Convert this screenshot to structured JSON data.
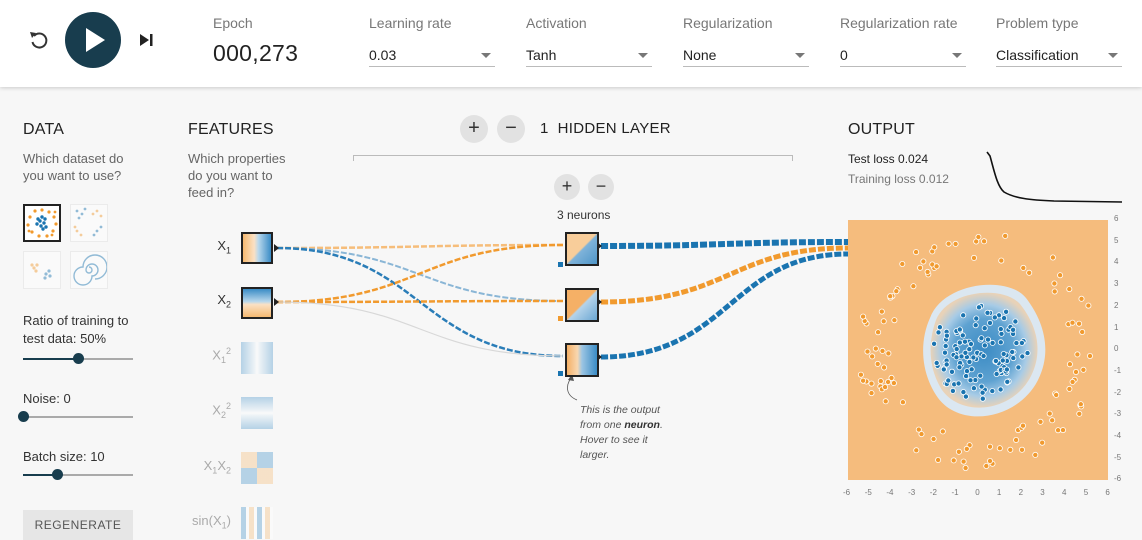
{
  "controls": {
    "epoch_label": "Epoch",
    "epoch_value": "000,273",
    "learning_rate": {
      "label": "Learning rate",
      "value": "0.03"
    },
    "activation": {
      "label": "Activation",
      "value": "Tanh"
    },
    "regularization": {
      "label": "Regularization",
      "value": "None"
    },
    "regularization_rate": {
      "label": "Regularization rate",
      "value": "0"
    },
    "problem_type": {
      "label": "Problem type",
      "value": "Classification"
    }
  },
  "data_panel": {
    "heading": "DATA",
    "question_line1": "Which dataset do",
    "question_line2": "you want to use?",
    "datasets": [
      "circle",
      "xor",
      "gaussian",
      "spiral"
    ],
    "selected_dataset": "circle",
    "ratio_label_line1": "Ratio of training to",
    "ratio_label_line2": "test data:  50%",
    "ratio_value": 50,
    "noise_label": "Noise:  0",
    "noise_value": 0,
    "batch_label": "Batch size:  10",
    "batch_value": 10,
    "regenerate_label": "REGENERATE"
  },
  "features_panel": {
    "heading": "FEATURES",
    "question_line1": "Which properties",
    "question_line2": "do you want to",
    "question_line3": "feed in?",
    "features": [
      {
        "base": "X",
        "sub": "1",
        "sup": "",
        "active": true
      },
      {
        "base": "X",
        "sub": "2",
        "sup": "",
        "active": true
      },
      {
        "base": "X",
        "sub": "1",
        "sup": "2",
        "active": false
      },
      {
        "base": "X",
        "sub": "2",
        "sup": "2",
        "active": false
      },
      {
        "base": "X",
        "sub": "1",
        "base2": "X",
        "sub2": "2",
        "active": false
      },
      {
        "base": "sin(X",
        "sub": "1",
        "close": ")",
        "active": false
      }
    ]
  },
  "hidden_layers": {
    "count": "1",
    "title": "HIDDEN LAYER",
    "add_symbol": "+",
    "remove_symbol": "−",
    "layer_neurons_label": "3 neurons",
    "neurons": 3
  },
  "annotation": {
    "line1": "This is the output",
    "line2a": "from one ",
    "line2b": "neuron",
    "line2c": ".",
    "line3": "Hover to see it",
    "line4": "larger."
  },
  "output_panel": {
    "heading": "OUTPUT",
    "test_loss_label": "Test loss ",
    "test_loss_value": "0.024",
    "training_loss_label": "Training loss ",
    "training_loss_value": "0.012",
    "y_ticks": [
      "6",
      "5",
      "4",
      "3",
      "2",
      "1",
      "0",
      "-1",
      "-2",
      "-3",
      "-4",
      "-5",
      "-6"
    ],
    "x_ticks": [
      "-6",
      "-5",
      "-4",
      "-3",
      "-2",
      "-1",
      "0",
      "1",
      "2",
      "3",
      "4",
      "5",
      "6"
    ]
  },
  "colors": {
    "positive": "#1a74b0",
    "negative": "#f19a2e",
    "dark": "#183d4e"
  }
}
